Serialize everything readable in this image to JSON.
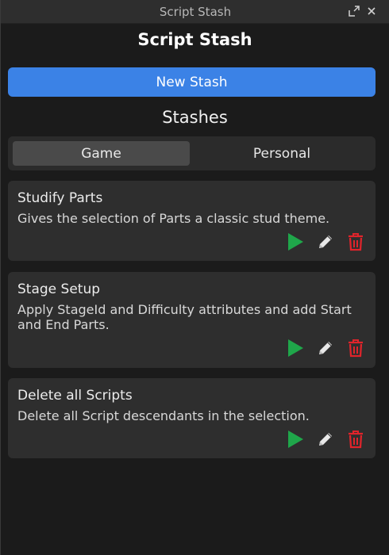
{
  "window": {
    "title": "Script Stash"
  },
  "header": {
    "title": "Script Stash",
    "new_stash_label": "New Stash"
  },
  "stashes": {
    "heading": "Stashes",
    "tabs": [
      {
        "label": "Game",
        "active": true
      },
      {
        "label": "Personal",
        "active": false
      }
    ],
    "items": [
      {
        "title": "Studify Parts",
        "description": "Gives the selection of Parts a classic stud theme."
      },
      {
        "title": "Stage Setup",
        "description": "Apply StageId and Difficulty attributes and add Start and End Parts."
      },
      {
        "title": "Delete all Scripts",
        "description": "Delete all Script descendants in the selection."
      }
    ]
  },
  "icons": {
    "popout": "popout-icon",
    "close": "close-icon",
    "run": "play-icon",
    "edit": "pencil-icon",
    "delete": "trash-icon"
  },
  "colors": {
    "accent": "#3b82e6",
    "run": "#1fa64a",
    "delete": "#e0242b",
    "edit": "#e8e8e8",
    "background": "#1b1b1b",
    "card": "#2e2e2e"
  }
}
